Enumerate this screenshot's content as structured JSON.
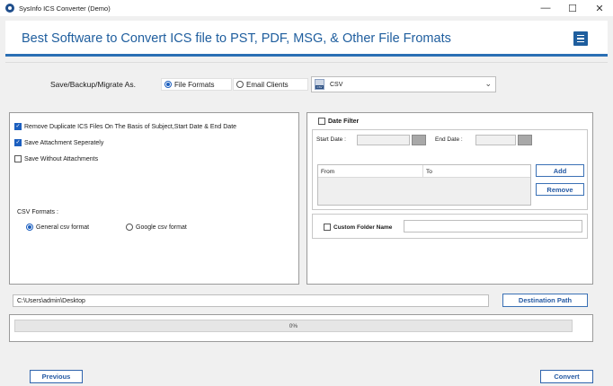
{
  "window": {
    "title": "SysInfo ICS Converter (Demo)",
    "controls": {
      "minimize": "—",
      "maximize": "☐",
      "close": "✕"
    }
  },
  "banner": {
    "title": "Best Software to Convert ICS file to PST, PDF, MSG, & Other File Fromats",
    "menu_icon": "hamburger-menu-icon",
    "accent_color": "#1f5e9e"
  },
  "save_as": {
    "label": "Save/Backup/Migrate As.",
    "options": [
      {
        "label": "File Formats",
        "selected": true
      },
      {
        "label": "Email Clients",
        "selected": false
      }
    ],
    "format_select": {
      "value": "CSV",
      "icon": "csv-file-icon"
    }
  },
  "options": {
    "checkboxes": [
      {
        "label": "Remove Duplicate ICS Files On The Basis of Subject,Start Date & End Date",
        "checked": true
      },
      {
        "label": "Save Attachment Seperately",
        "checked": true
      },
      {
        "label": "Save Without Attachments",
        "checked": false
      }
    ],
    "csv_formats": {
      "label": "CSV Formats :",
      "options": [
        {
          "label": "General csv format",
          "selected": true
        },
        {
          "label": "Google csv format",
          "selected": false
        }
      ]
    }
  },
  "date_filter": {
    "label": "Date Filter",
    "checked": false,
    "start_label": "Start Date :",
    "end_label": "End Date :",
    "table_headers": [
      "From",
      "To"
    ],
    "add_label": "Add",
    "remove_label": "Remove"
  },
  "custom_folder": {
    "label": "Custom Folder Name",
    "checked": false,
    "value": ""
  },
  "destination": {
    "path": "C:\\Users\\admin\\Desktop",
    "button_label": "Destination Path"
  },
  "progress": {
    "value": 0,
    "label": "0%",
    "fill_color": "#1c7bd6"
  },
  "footer": {
    "previous_label": "Previous",
    "convert_label": "Convert"
  }
}
